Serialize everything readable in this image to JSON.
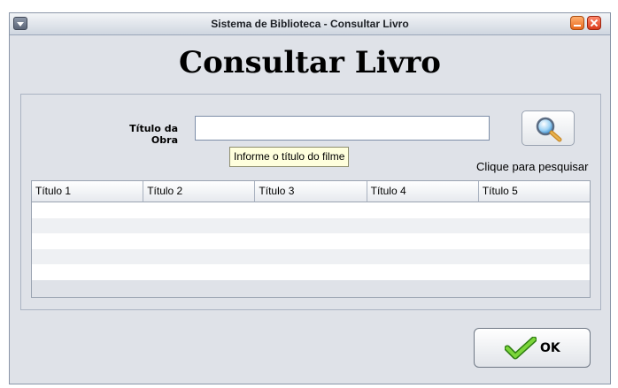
{
  "window": {
    "title": "Sistema de Biblioteca - Consultar Livro"
  },
  "page": {
    "heading": "Consultar Livro"
  },
  "search": {
    "label": "Título da Obra",
    "value": "",
    "tooltip": "Informe o título do filme",
    "hint": "Clique para pesquisar"
  },
  "table": {
    "headers": [
      "Título 1",
      "Título 2",
      "Título 3",
      "Título 4",
      "Título 5"
    ],
    "rows": [
      [
        "",
        "",
        "",
        "",
        ""
      ],
      [
        "",
        "",
        "",
        "",
        ""
      ],
      [
        "",
        "",
        "",
        "",
        ""
      ],
      [
        "",
        "",
        "",
        "",
        ""
      ],
      [
        "",
        "",
        "",
        "",
        ""
      ]
    ]
  },
  "ok_button": {
    "label": "OK"
  },
  "icons": {
    "search": "magnifier-icon",
    "ok": "checkmark-icon",
    "minimize": "minimize-icon",
    "close": "close-icon",
    "menu": "window-menu-icon"
  }
}
